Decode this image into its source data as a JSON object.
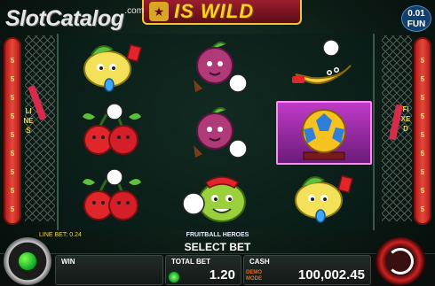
{
  "watermark": {
    "brand": "SlotCatalog",
    "tld": ".com"
  },
  "banner": {
    "text": "IS WILD",
    "icon": "trophy-icon"
  },
  "fun_badge": {
    "value": "0.01",
    "label": "FUN"
  },
  "left_pillar": [
    "5",
    "5",
    "5",
    "5",
    "5",
    "5",
    "5",
    "5",
    "5",
    "5"
  ],
  "right_pillar": [
    "5",
    "5",
    "5",
    "5",
    "5",
    "5",
    "5",
    "5",
    "5",
    "5"
  ],
  "side_labels": {
    "left": "LINES",
    "right": "FIXED"
  },
  "reels": [
    [
      "lemon-referee",
      "cherries",
      "cherries"
    ],
    [
      "plum",
      "plum",
      "pear-keeper"
    ],
    [
      "banana-kicker",
      "golden-ball-bonus",
      "lemon-referee"
    ]
  ],
  "info": {
    "line_bet": "LINE BET: 0.24",
    "game_name": "FRUITBALL HEROES",
    "prompt": "SELECT BET"
  },
  "bottom_bar": {
    "win_label": "WIN",
    "win_value": "",
    "total_bet_label": "TOTAL BET",
    "total_bet_value": "1.20",
    "cash_label": "CASH",
    "cash_value": "100,002.45",
    "mode": "DEMO MODE"
  },
  "colors": {
    "banner_text": "#ffd21e",
    "pillar": "#e8473a",
    "highlight": "#c03ac8",
    "prompt": "#ffffff"
  }
}
